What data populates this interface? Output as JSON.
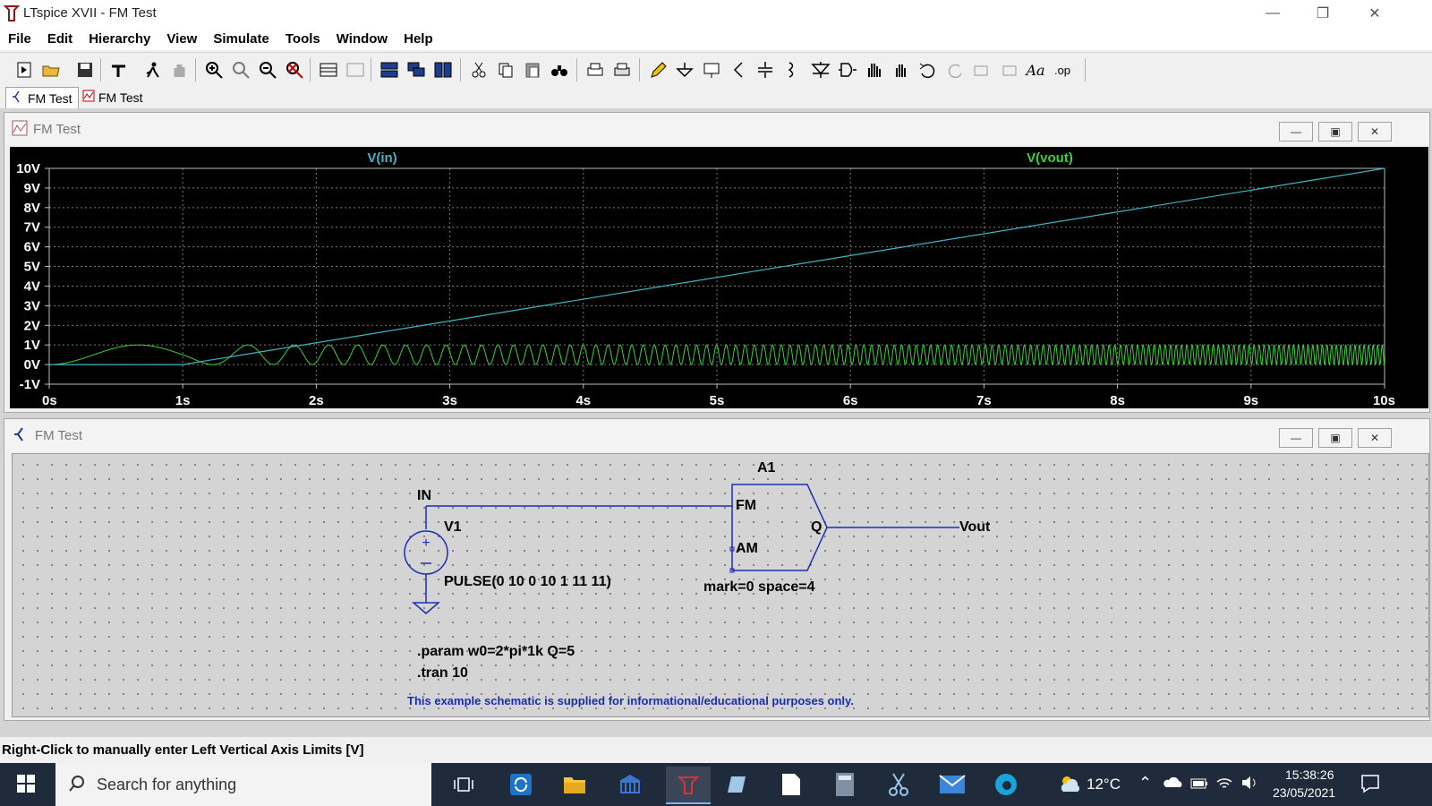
{
  "window": {
    "title": "LTspice XVII - FM Test"
  },
  "menu": [
    "File",
    "Edit",
    "Hierarchy",
    "View",
    "Simulate",
    "Tools",
    "Window",
    "Help"
  ],
  "tabs": [
    {
      "label": "FM Test",
      "kind": "schematic"
    },
    {
      "label": "FM Test",
      "kind": "waveform"
    }
  ],
  "waveform_window": {
    "title": "FM Test",
    "traces": [
      {
        "name": "V(in)",
        "color": "#3fb6c6"
      },
      {
        "name": "V(vout)",
        "color": "#37d437"
      }
    ]
  },
  "chart_data": {
    "type": "line",
    "title": "",
    "xlabel": "",
    "ylabel": "",
    "x_ticks": [
      "0s",
      "1s",
      "2s",
      "3s",
      "4s",
      "5s",
      "6s",
      "7s",
      "8s",
      "9s",
      "10s"
    ],
    "y_ticks": [
      "10V",
      "9V",
      "8V",
      "7V",
      "6V",
      "5V",
      "4V",
      "3V",
      "2V",
      "1V",
      "0V",
      "-1V"
    ],
    "xlim": [
      0,
      10
    ],
    "ylim": [
      -1,
      10
    ],
    "grid": true,
    "series": [
      {
        "name": "V(in)",
        "x": [
          0,
          1,
          10
        ],
        "y": [
          0,
          0,
          10
        ],
        "color": "#3fb6c6"
      },
      {
        "name": "V(vout)",
        "description_free": true,
        "x": [
          0,
          10
        ],
        "y": [
          0,
          1
        ],
        "color": "#37d437"
      }
    ]
  },
  "schematic_window": {
    "title": "FM Test",
    "labels": {
      "in_net": "IN",
      "source_ref": "V1",
      "source_value": "PULSE(0 10 0 10 1 11 11)",
      "block_ref": "A1",
      "pin_fm": "FM",
      "pin_am": "AM",
      "pin_q": "Q",
      "block_params": "mark=0 space=4",
      "out_net": "Vout",
      "param_directive": ".param w0=2*pi*1k Q=5",
      "tran_directive": ".tran 10",
      "disclaimer": "This example schematic is supplied for informational/educational purposes only."
    }
  },
  "status": {
    "text": "Right-Click to manually enter Left Vertical Axis Limits [V]"
  },
  "taskbar": {
    "search_placeholder": "Search for anything",
    "temperature": "12°C",
    "time": "15:38:26",
    "date": "23/05/2021"
  }
}
